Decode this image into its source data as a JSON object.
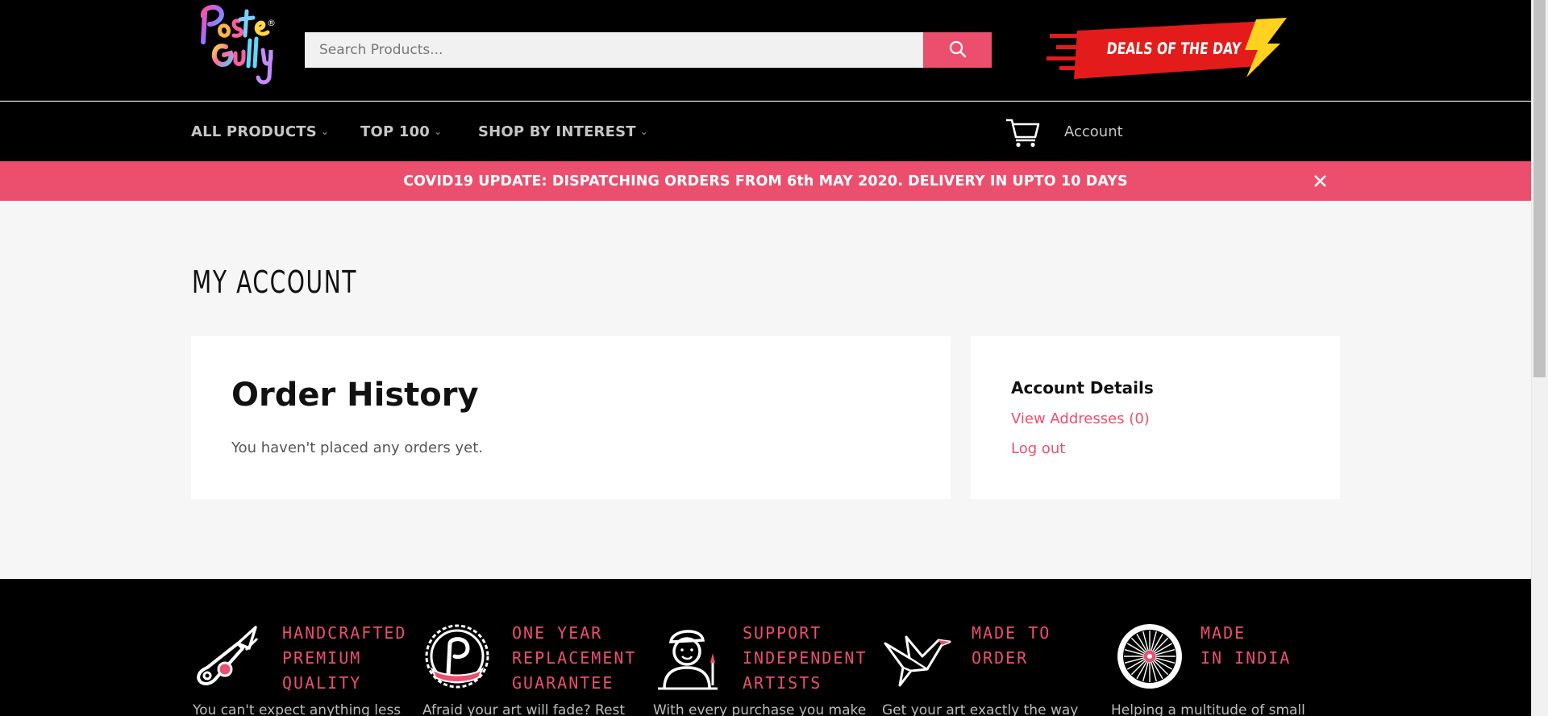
{
  "header": {
    "logo_alt": "Poster Gully",
    "logo_mark": "®",
    "search": {
      "placeholder": "Search Products..."
    },
    "deals_label": "DEALS OF THE DAY"
  },
  "nav": {
    "items": [
      {
        "label": "ALL PRODUCTS"
      },
      {
        "label": "TOP 100"
      },
      {
        "label": "SHOP BY INTEREST"
      }
    ],
    "account_label": "Account"
  },
  "announcement": {
    "text": "COVID19 UPDATE: DISPATCHING ORDERS FROM 6th MAY 2020. DELIVERY IN UPTO 10 DAYS"
  },
  "main": {
    "title": "MY ACCOUNT",
    "orders": {
      "heading": "Order History",
      "empty_message": "You haven't placed any orders yet."
    },
    "account": {
      "heading": "Account Details",
      "view_addresses": "View Addresses (0)",
      "logout": "Log out"
    }
  },
  "footer": {
    "features": [
      {
        "title_lines": [
          "HANDCRAFTED",
          "PREMIUM",
          "QUALITY"
        ],
        "desc": "You can't expect anything less",
        "icon": "craft-knife-icon"
      },
      {
        "title_lines": [
          "ONE YEAR",
          "REPLACEMENT",
          "GUARANTEE"
        ],
        "desc": "Afraid your art will fade? Rest",
        "icon": "guarantee-seal-icon"
      },
      {
        "title_lines": [
          "SUPPORT",
          "INDEPENDENT",
          "ARTISTS"
        ],
        "desc": "With every purchase you make",
        "icon": "artist-icon"
      },
      {
        "title_lines": [
          "MADE TO",
          "ORDER"
        ],
        "desc": "Get your art exactly the way",
        "icon": "origami-bird-icon"
      },
      {
        "title_lines": [
          "MADE",
          "IN INDIA"
        ],
        "desc": "Helping a multitude of small",
        "icon": "ashoka-chakra-icon"
      }
    ]
  },
  "colors": {
    "accent": "#ec4f6d",
    "header_bg": "#000000",
    "page_bg": "#f6f6f6"
  }
}
